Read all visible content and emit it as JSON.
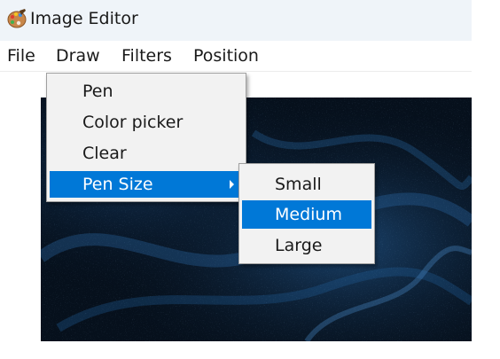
{
  "window": {
    "title": "Image Editor",
    "app_icon": "palette-icon"
  },
  "menubar": {
    "items": [
      {
        "label": "File"
      },
      {
        "label": "Draw"
      },
      {
        "label": "Filters"
      },
      {
        "label": "Position"
      }
    ]
  },
  "draw_menu": {
    "items": [
      {
        "label": "Pen"
      },
      {
        "label": "Color picker"
      },
      {
        "label": "Clear"
      },
      {
        "label": "Pen Size",
        "has_submenu": true,
        "highlighted": true
      }
    ]
  },
  "pen_size_submenu": {
    "items": [
      {
        "label": "Small"
      },
      {
        "label": "Medium",
        "highlighted": true
      },
      {
        "label": "Large"
      }
    ]
  },
  "colors": {
    "highlight": "#0078d7",
    "menu_background": "#f2f2f2",
    "titlebar_background": "#eff4f9",
    "canvas_background": "#06101c"
  }
}
